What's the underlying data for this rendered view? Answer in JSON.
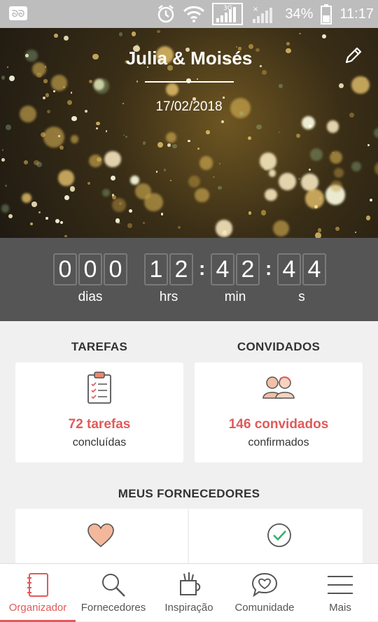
{
  "status_bar": {
    "battery": "34%",
    "time": "11:17",
    "network": "3G"
  },
  "hero": {
    "couple": "Julia & Moisés",
    "date": "17/02/2018"
  },
  "countdown": {
    "days": [
      "0",
      "0",
      "0"
    ],
    "hours": [
      "1",
      "2"
    ],
    "minutes": [
      "4",
      "2"
    ],
    "seconds": [
      "4",
      "4"
    ],
    "labels": {
      "days": "dias",
      "hours": "hrs",
      "minutes": "min",
      "seconds": "s"
    }
  },
  "tasks": {
    "title": "TAREFAS",
    "count": "72 tarefas",
    "sub": "concluídas"
  },
  "guests": {
    "title": "CONVIDADOS",
    "count": "146 convidados",
    "sub": "confirmados"
  },
  "suppliers": {
    "title": "MEUS FORNECEDORES"
  },
  "bottom_nav": [
    {
      "label": "Organizador",
      "icon": "notebook-icon",
      "active": true
    },
    {
      "label": "Fornecedores",
      "icon": "search-icon",
      "active": false
    },
    {
      "label": "Inspiração",
      "icon": "inspiration-icon",
      "active": false
    },
    {
      "label": "Comunidade",
      "icon": "chat-heart-icon",
      "active": false
    },
    {
      "label": "Mais",
      "icon": "menu-icon",
      "active": false
    }
  ],
  "colors": {
    "accent": "#e05a5a",
    "countdown_bg": "#555556",
    "status_bar": "#bdbdbd"
  }
}
